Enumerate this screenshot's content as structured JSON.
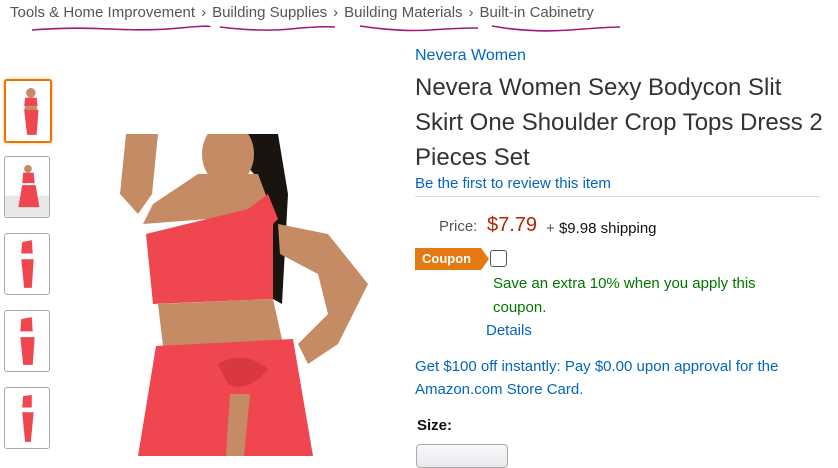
{
  "breadcrumb": {
    "items": [
      "Tools & Home Improvement",
      "Building Supplies",
      "Building Materials",
      "Built-in Cabinetry"
    ],
    "separator": "›"
  },
  "product": {
    "brand": "Nevera Women",
    "title": "Nevera Women Sexy Bodycon Slit Skirt One Shoulder Crop Tops Dress 2 Pieces Set",
    "review_link": "Be the first to review this item",
    "price_label": "Price:",
    "price": "$7.79",
    "shipping_plus": "+",
    "shipping": "$9.98 shipping",
    "coupon": {
      "badge": "Coupon",
      "text": "Save an extra 10% when you apply this coupon.",
      "details": "Details"
    },
    "card_offer": "Get $100 off instantly: Pay $0.00 upon approval for the Amazon.com Store Card.",
    "size_label": "Size:"
  },
  "colors": {
    "link": "#0066c0",
    "price": "#b12704",
    "coupon_badge": "#e47911",
    "coupon_text": "#007600",
    "annotation_underline": "#a0167c",
    "dress": "#f0464f"
  },
  "thumbnails": [
    "thumbnail-1",
    "thumbnail-2",
    "thumbnail-3",
    "thumbnail-4",
    "thumbnail-5"
  ]
}
